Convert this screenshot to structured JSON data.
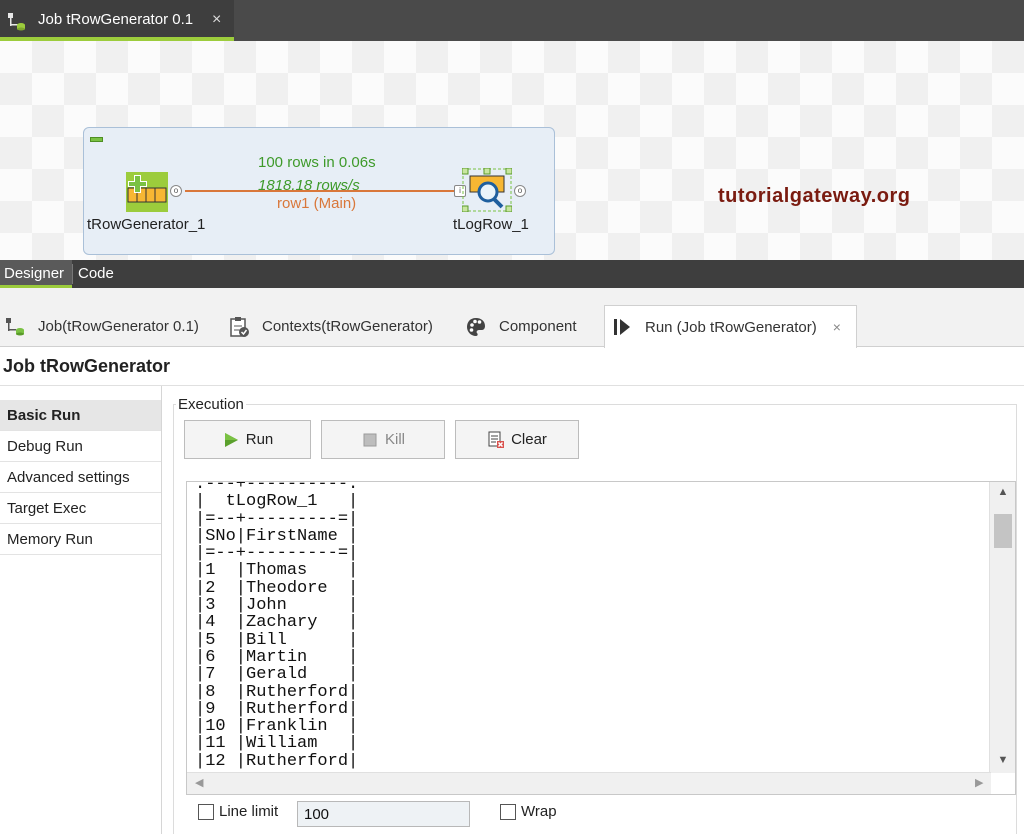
{
  "editor_tab": {
    "title": "Job tRowGenerator 0.1",
    "close": "×"
  },
  "canvas": {
    "source_component": "tRowGenerator_1",
    "target_component": "tLogRow_1",
    "link_stat_rows": "100 rows in 0.06s",
    "link_stat_rate": "1818.18 rows/s",
    "link_name": "row1 (Main)",
    "watermark": "tutorialgateway.org"
  },
  "view_tabs": {
    "designer": "Designer",
    "code": "Code"
  },
  "panel_tabs": [
    {
      "label": "Job(tRowGenerator 0.1)",
      "icon": "job-icon"
    },
    {
      "label": "Contexts(tRowGenerator)",
      "icon": "contexts-icon"
    },
    {
      "label": "Component",
      "icon": "palette-icon"
    },
    {
      "label": "Run (Job tRowGenerator)",
      "icon": "run-panel-icon",
      "close": "×"
    }
  ],
  "panel_title": "Job tRowGenerator",
  "side_nav": [
    "Basic Run",
    "Debug Run",
    "Advanced settings",
    "Target Exec",
    "Memory Run"
  ],
  "execution": {
    "legend": "Execution",
    "run_label": "Run",
    "kill_label": "Kill",
    "clear_label": "Clear"
  },
  "console": {
    "lines": [
      ".---+----------.",
      "|  tLogRow_1   |",
      "|=--+---------=|",
      "|SNo|FirstName |",
      "|=--+---------=|",
      "|1  |Thomas    |",
      "|2  |Theodore  |",
      "|3  |John      |",
      "|4  |Zachary   |",
      "|5  |Bill      |",
      "|6  |Martin    |",
      "|7  |Gerald    |",
      "|8  |Rutherford|",
      "|9  |Rutherford|",
      "|10 |Franklin  |",
      "|11 |William   |",
      "|12 |Rutherford|"
    ]
  },
  "bottom": {
    "line_limit_label": "Line limit",
    "line_limit_value": "100",
    "wrap_label": "Wrap"
  }
}
